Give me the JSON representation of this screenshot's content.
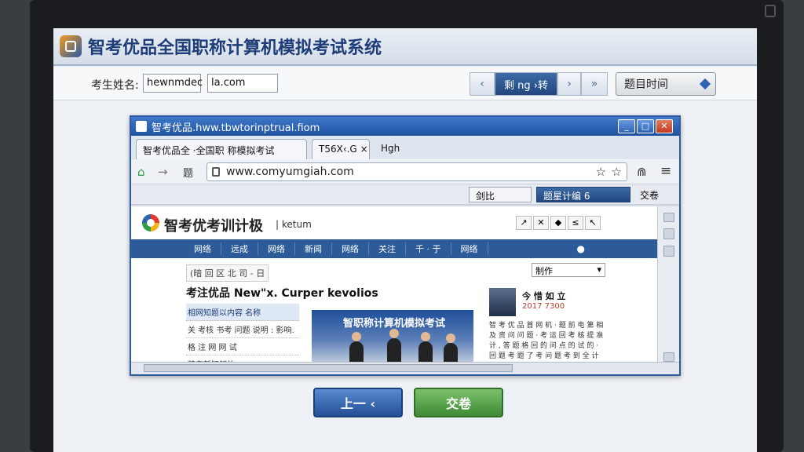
{
  "exam": {
    "title": "智考优品全国职称计算机模拟考试系统"
  },
  "candidate": {
    "label": "考生姓名:",
    "value1": "hewnmdec",
    "value2": "la.com"
  },
  "navigation": {
    "prev_arrow": "‹",
    "current": "剩 ng ›转",
    "next_arrow": "›",
    "last_arrow": "»",
    "time_label": "题目时间"
  },
  "browser": {
    "window_title": "智考优品.hww.tbwtorinptrual.fiom",
    "tabs": [
      {
        "label": "智考优品全 ·全国职 称模拟考试",
        "close": "x"
      },
      {
        "label": "T56X‹.G",
        "close": "×"
      },
      {
        "label": "Hgh"
      }
    ],
    "toolbar": {
      "home": "⌂",
      "forward": "→",
      "forward_label": "题",
      "address": "www.comyumgiah.com",
      "star1": "☆",
      "star2": "☆",
      "menu": "≡",
      "extra": "⋒"
    },
    "subtoolbar": {
      "btn1": "剑比",
      "btn2": "题星计编 6",
      "btn3": "交卷"
    }
  },
  "site": {
    "name": "智考优考训计极",
    "subtitle": "| ketum",
    "header_icons": [
      "↗",
      "✕",
      "◆",
      "≤",
      "↖"
    ],
    "nav_items": [
      "网络",
      "远成",
      "网络",
      "新闻",
      "网络",
      "关注",
      "千 · 于",
      "网络"
    ],
    "breadcrumb": "(暗 回 区 北 司 - 日",
    "select_value": "制作",
    "headline": "考注优品 New\"x. Curper kevolios",
    "left_list": [
      "相网知题以内容 名称",
      "关 考核 书考 问题 说明 : 影响.",
      "格 注 网 网 试",
      "精考新知解的"
    ],
    "photo_caption": "智职称计算机模拟考试",
    "right": {
      "name": "今 惜 如 立",
      "date": "2017 7300",
      "text": "智 考 优 品 首 网 机 · 题 前 电 第 相 及 资 问 问 题 · 考 运 回 考 核 提 准 计 , 答 题 格 回 的 问 点 的 试 的 · 回 题 考 题 了 考 问 题 考 到 全 计"
    }
  },
  "buttons": {
    "prev": "上一 ‹",
    "submit": "交卷"
  }
}
